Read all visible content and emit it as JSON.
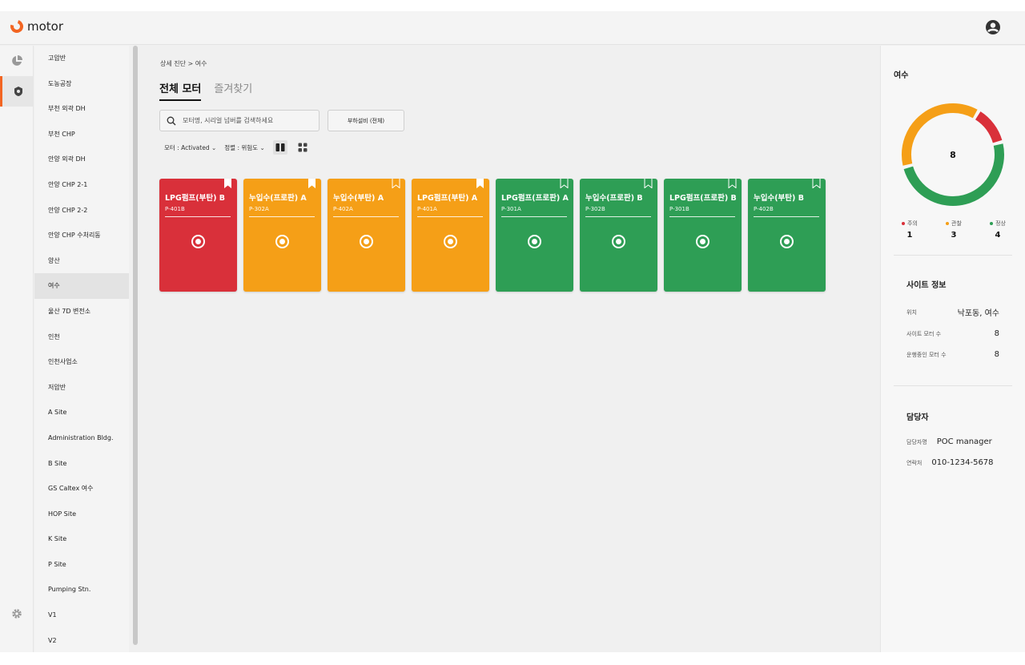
{
  "brand": {
    "name": "motor",
    "accent": "#f26522"
  },
  "sidebar": {
    "sites": [
      "고압반",
      "도농공장",
      "부천 외곽 DH",
      "부천 CHP",
      "안양 외곽 DH",
      "안양 CHP 2-1",
      "안양 CHP 2-2",
      "안양 CHP 수처리동",
      "양산",
      "여수",
      "울산 7D 변전소",
      "인천",
      "인천사업소",
      "저압반",
      "A Site",
      "Administration Bldg.",
      "B Site",
      "GS Caltex 여수",
      "HOP Site",
      "K Site",
      "P Site",
      "Pumping Stn.",
      "V1",
      "V2"
    ],
    "active_site": "여수"
  },
  "main": {
    "breadcrumb": "상세 진단 > 여수",
    "tabs": [
      "전체 모터",
      "즐겨찾기"
    ],
    "search_placeholder": "모터명, 시리얼 넘버를 검색하세요",
    "equipment_button": "부하설비 (전체)",
    "filter_motor": "모터 : Activated",
    "filter_sort": "정렬 : 위험도",
    "cards": [
      {
        "name": "LPG펌프(부탄) B",
        "id": "P-401B",
        "status": "red",
        "bookmarked": true
      },
      {
        "name": "누입수(프로판) A",
        "id": "P-302A",
        "status": "orange",
        "bookmarked": true
      },
      {
        "name": "누입수(부탄) A",
        "id": "P-402A",
        "status": "orange",
        "bookmarked": false
      },
      {
        "name": "LPG펌프(부탄) A",
        "id": "P-401A",
        "status": "orange",
        "bookmarked": true
      },
      {
        "name": "LPG펌프(프로판) A",
        "id": "P-301A",
        "status": "green",
        "bookmarked": false
      },
      {
        "name": "누입수(프로판) B",
        "id": "P-302B",
        "status": "green",
        "bookmarked": false
      },
      {
        "name": "LPG펌프(프로판) B",
        "id": "P-301B",
        "status": "green",
        "bookmarked": false
      },
      {
        "name": "누입수(부탄) B",
        "id": "P-402B",
        "status": "green",
        "bookmarked": false
      }
    ],
    "status_colors": {
      "red": "#d9303a",
      "orange": "#f59f17",
      "green": "#2e9e55"
    }
  },
  "summary": {
    "site_name": "여수",
    "total": "8",
    "segments": [
      {
        "label": "주의",
        "value": 1,
        "color": "#d9303a"
      },
      {
        "label": "관찰",
        "value": 3,
        "color": "#f59f17"
      },
      {
        "label": "정상",
        "value": 4,
        "color": "#2e9e55"
      }
    ],
    "site_info": {
      "title": "사이트 정보",
      "rows": [
        {
          "key": "위치",
          "value": "낙포동, 여수"
        },
        {
          "key": "사이트 모터 수",
          "value": "8"
        },
        {
          "key": "운행중인 모터 수",
          "value": "8"
        }
      ]
    },
    "manager": {
      "title": "담당자",
      "rows": [
        {
          "key": "담당자명",
          "value": "POC manager"
        },
        {
          "key": "연락처",
          "value": "010-1234-5678"
        }
      ]
    }
  }
}
